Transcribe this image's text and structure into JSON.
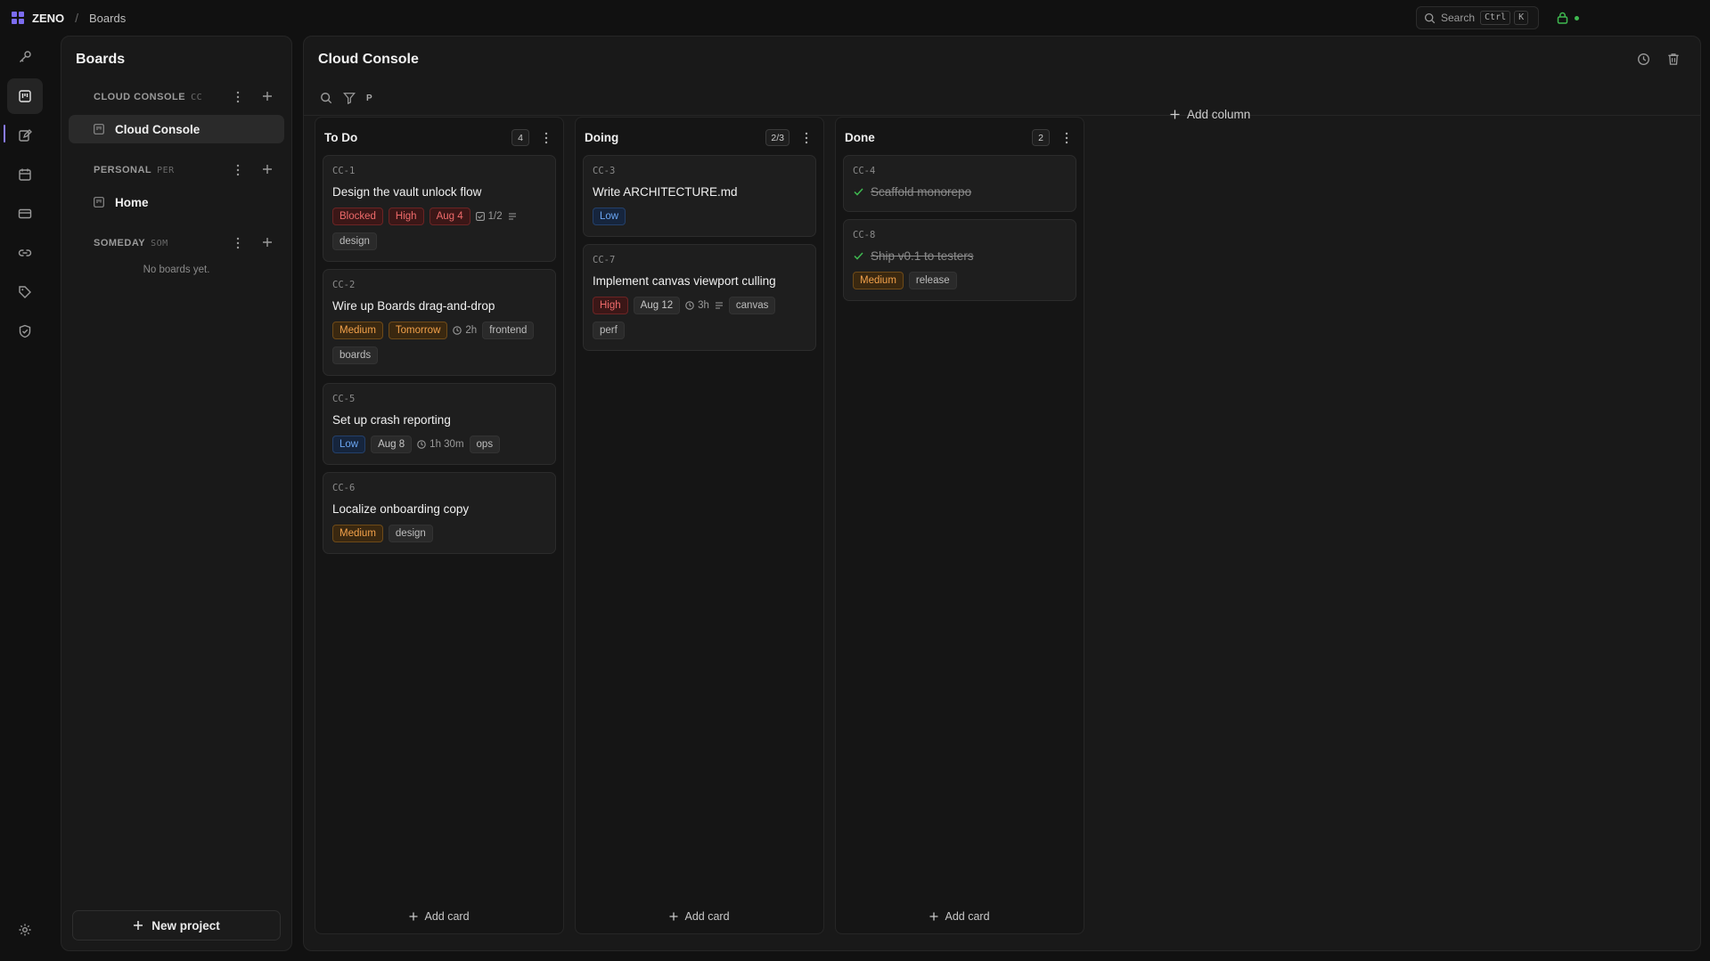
{
  "topbar": {
    "brand": "ZENO",
    "breadcrumb_sep": "/",
    "breadcrumb": "Boards",
    "search_label": "Search",
    "kbd_ctrl": "Ctrl",
    "kbd_k": "K"
  },
  "rail": {
    "icons": [
      "key-icon",
      "boards-icon",
      "notes-icon",
      "calendar-icon",
      "card-icon",
      "link-icon",
      "tag-icon",
      "shield-icon",
      "settings-icon"
    ]
  },
  "sidebar": {
    "title": "Boards",
    "groups": [
      {
        "name": "CLOUD CONSOLE",
        "code": "CC",
        "boards": [
          "Cloud Console"
        ]
      },
      {
        "name": "PERSONAL",
        "code": "PER",
        "boards": [
          "Home"
        ]
      },
      {
        "name": "SOMEDAY",
        "code": "SOM",
        "boards": [],
        "empty": "No boards yet."
      }
    ],
    "new_project": "New project"
  },
  "board": {
    "title": "Cloud Console",
    "toolbar_p": "P",
    "add_column": "Add column",
    "add_card": "Add card",
    "columns": [
      {
        "title": "To Do",
        "count": "4",
        "cards": [
          {
            "id": "CC-1",
            "title": "Design the vault unlock flow",
            "priority": "High",
            "status": "Blocked",
            "date": "Aug 4",
            "checklist": "1/2",
            "labels": [
              "design"
            ]
          },
          {
            "id": "CC-2",
            "title": "Wire up Boards drag-and-drop",
            "priority": "Medium",
            "date": "Tomorrow",
            "estimate": "2h",
            "labels": [
              "frontend",
              "boards"
            ]
          },
          {
            "id": "CC-5",
            "title": "Set up crash reporting",
            "priority": "Low",
            "date": "Aug 8",
            "estimate": "1h 30m",
            "labels": [
              "ops"
            ]
          },
          {
            "id": "CC-6",
            "title": "Localize onboarding copy",
            "priority": "Medium",
            "labels": [
              "design"
            ]
          }
        ]
      },
      {
        "title": "Doing",
        "count": "2/3",
        "cards": [
          {
            "id": "CC-3",
            "title": "Write ARCHITECTURE.md",
            "priority": "Low"
          },
          {
            "id": "CC-7",
            "title": "Implement canvas viewport culling",
            "priority": "High",
            "date": "Aug 12",
            "estimate": "3h",
            "labels": [
              "canvas",
              "perf"
            ]
          }
        ]
      },
      {
        "title": "Done",
        "count": "2",
        "cards": [
          {
            "id": "CC-4",
            "title": "Scaffold monorepo",
            "done": true
          },
          {
            "id": "CC-8",
            "title": "Ship v0.1 to testers",
            "done": true,
            "priority": "Medium",
            "labels": [
              "release"
            ]
          }
        ]
      }
    ]
  },
  "colors": {
    "accent": "#8a7cff",
    "red": "#ee6a6a",
    "orange": "#f2a14a",
    "blue": "#6aa5f2",
    "online": "#3fb950"
  }
}
